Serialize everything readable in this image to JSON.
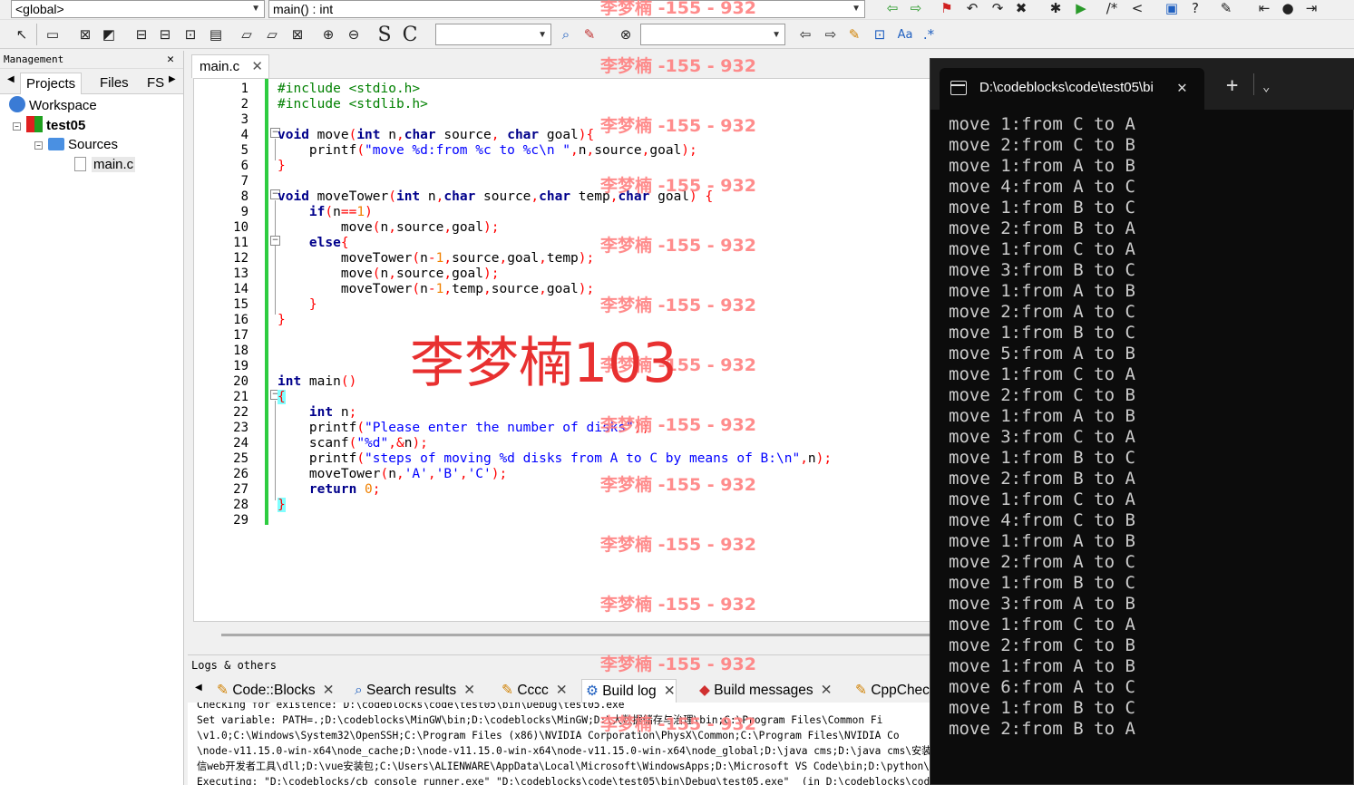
{
  "toolbar": {
    "scope_combo": "<global>",
    "function_combo": "main() : int"
  },
  "management": {
    "title": "Management",
    "tabs": [
      "Projects",
      "Files",
      "FS"
    ],
    "tree": {
      "workspace": "Workspace",
      "project": "test05",
      "folder": "Sources",
      "file": "main.c"
    }
  },
  "editor": {
    "tab_label": "main.c",
    "line_numbers": [
      "1",
      "2",
      "3",
      "4",
      "5",
      "6",
      "7",
      "8",
      "9",
      "10",
      "11",
      "12",
      "13",
      "14",
      "15",
      "16",
      "17",
      "18",
      "19",
      "20",
      "21",
      "22",
      "23",
      "24",
      "25",
      "26",
      "27",
      "28",
      "29"
    ]
  },
  "logs": {
    "title": "Logs & others",
    "tabs": [
      "Code::Blocks",
      "Search results",
      "Cccc",
      "Build log",
      "Build messages",
      "CppChec"
    ],
    "lines": [
      "Checking for existence: D:\\codeblocks\\code\\test05\\bin\\Debug\\test05.exe",
      "Set variable: PATH=.;D:\\codeblocks\\MinGW\\bin;D:\\codeblocks\\MinGW;D:\\大数据储存与治理\\bin;C:\\Program Files\\Common Fi",
      "\\v1.0;C:\\Windows\\System32\\OpenSSH;C:\\Program Files (x86)\\NVIDIA Corporation\\PhysX\\Common;C:\\Program Files\\NVIDIA Co",
      "\\node-v11.15.0-win-x64\\node_cache;D:\\node-v11.15.0-win-x64\\node-v11.15.0-win-x64\\node_global;D:\\java cms;D:\\java cms\\安装包\\apache-maven-3.6.3-bin\\apache-maven-3.6.3\\bin;C:\\Program F",
      "信web开发者工具\\dll;D:\\vue安装包;C:\\Users\\ALIENWARE\\AppData\\Local\\Microsoft\\WindowsApps;D:\\Microsoft VS Code\\bin;D:\\python\\PyCharm Community Edition 2024.1.1\\bin;\\;C:\\Users\\ALIENWARE",
      "Executing: \"D:\\codeblocks/cb_console_runner.exe\" \"D:\\codeblocks\\code\\test05\\bin\\Debug\\test05.exe\"  (in D:\\codeblocks\\code\\test05\\.)"
    ]
  },
  "terminal": {
    "title": "D:\\codeblocks\\code\\test05\\bi",
    "new_tab": "+",
    "output": [
      "move 1:from C to A",
      "move 2:from C to B",
      "move 1:from A to B",
      "move 4:from A to C",
      "move 1:from B to C",
      "move 2:from B to A",
      "move 1:from C to A",
      "move 3:from B to C",
      "move 1:from A to B",
      "move 2:from A to C",
      "move 1:from B to C",
      "move 5:from A to B",
      "move 1:from C to A",
      "move 2:from C to B",
      "move 1:from A to B",
      "move 3:from C to A",
      "move 1:from B to C",
      "move 2:from B to A",
      "move 1:from C to A",
      "move 4:from C to B",
      "move 1:from A to B",
      "move 2:from A to C",
      "move 1:from B to C",
      "move 3:from A to B",
      "move 1:from C to A",
      "move 2:from C to B",
      "move 1:from A to B",
      "move 6:from A to C",
      "move 1:from B to C",
      "move 2:from B to A"
    ]
  },
  "watermark": {
    "small": "李梦楠 -155 - 932",
    "big": "李梦楠103"
  }
}
